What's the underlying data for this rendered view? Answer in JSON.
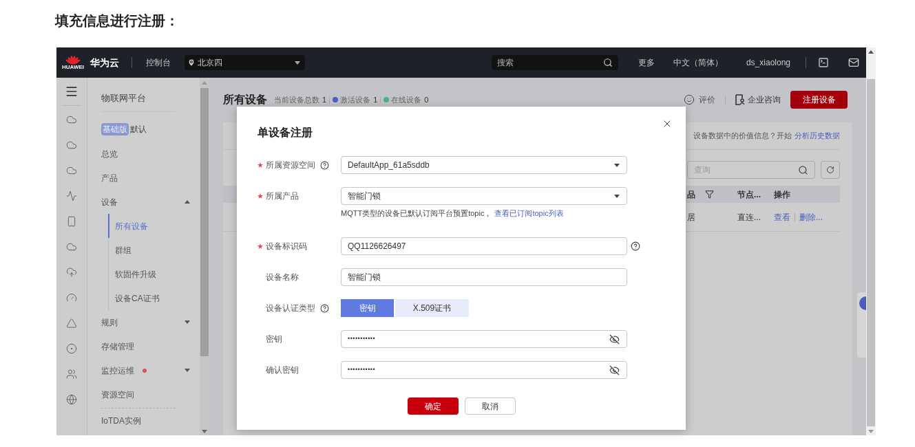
{
  "heading": "填充信息进行注册：",
  "topbar": {
    "logo_text": "HUAWEI",
    "brand": "华为云",
    "console": "控制台",
    "region": "北京四",
    "search_placeholder": "搜索",
    "links": [
      "更多",
      "中文（简体）",
      "ds_xiaolong"
    ]
  },
  "sidebar": {
    "title": "物联网平台",
    "edition_badge": "基础版",
    "instance": "默认",
    "items": [
      {
        "label": "总览",
        "kind": "link",
        "alert": false
      },
      {
        "label": "产品",
        "kind": "link",
        "alert": false
      },
      {
        "label": "设备",
        "kind": "group",
        "expanded": true,
        "alert": false,
        "children": [
          {
            "label": "所有设备",
            "selected": true
          },
          {
            "label": "群组",
            "selected": false
          },
          {
            "label": "软固件升级",
            "selected": false
          },
          {
            "label": "设备CA证书",
            "selected": false
          }
        ]
      },
      {
        "label": "规则",
        "kind": "group",
        "expanded": false,
        "alert": false
      },
      {
        "label": "存储管理",
        "kind": "link",
        "alert": false
      },
      {
        "label": "监控运维",
        "kind": "group",
        "expanded": false,
        "alert": true
      },
      {
        "label": "资源空间",
        "kind": "link",
        "alert": false
      },
      {
        "label": "IoTDA实例",
        "kind": "link",
        "alert": false
      }
    ]
  },
  "main": {
    "title": "所有设备",
    "stats": [
      {
        "label": "当前设备总数",
        "value": "1"
      },
      {
        "label": "激活设备",
        "value": "1",
        "color": "#4a5ec9"
      },
      {
        "label": "在线设备",
        "value": "0",
        "color": "#45b588"
      }
    ],
    "actions": [
      "评价",
      "企业咨询"
    ],
    "primary_button": "注册设备",
    "card": {
      "tip": "设备数据中的价值信息？开始",
      "tip_link": "分析历史数据",
      "search_placeholder": "查询",
      "columns": [
        "品",
        "节点...",
        "操作"
      ],
      "rows": [
        {
          "cells": [
            "居",
            "直连..."
          ],
          "actions": [
            "查看",
            "删除..."
          ]
        }
      ]
    }
  },
  "modal": {
    "title": "单设备注册",
    "fields": [
      {
        "label": "所属资源空间",
        "required": true,
        "label_help": true,
        "trailing_help": false,
        "kind": "select",
        "value": "DefaultApp_61a5sddb"
      },
      {
        "label": "所属产品",
        "required": true,
        "label_help": false,
        "trailing_help": false,
        "kind": "select",
        "value": "智能门锁",
        "hint": "MQTT类型的设备已默认订阅平台预置topic，",
        "hint_link": "查看已订阅topic列表"
      },
      {
        "label": "设备标识码",
        "required": true,
        "label_help": false,
        "trailing_help": true,
        "kind": "text",
        "value": "QQ1126626497"
      },
      {
        "label": "设备名称",
        "required": false,
        "label_help": false,
        "trailing_help": false,
        "kind": "text",
        "value": "智能门锁"
      },
      {
        "label": "设备认证类型",
        "required": false,
        "label_help": true,
        "trailing_help": false,
        "kind": "segmented",
        "options": [
          {
            "label": "密钥",
            "selected": true
          },
          {
            "label": "X.509证书",
            "selected": false
          }
        ]
      },
      {
        "label": "密钥",
        "required": false,
        "label_help": false,
        "trailing_help": false,
        "kind": "password",
        "value": "•••••••••••"
      },
      {
        "label": "确认密钥",
        "required": false,
        "label_help": false,
        "trailing_help": false,
        "kind": "password",
        "value": "•••••••••••"
      }
    ],
    "buttons": [
      {
        "label": "确定",
        "kind": "primary"
      },
      {
        "label": "取消",
        "kind": "secondary"
      }
    ]
  }
}
